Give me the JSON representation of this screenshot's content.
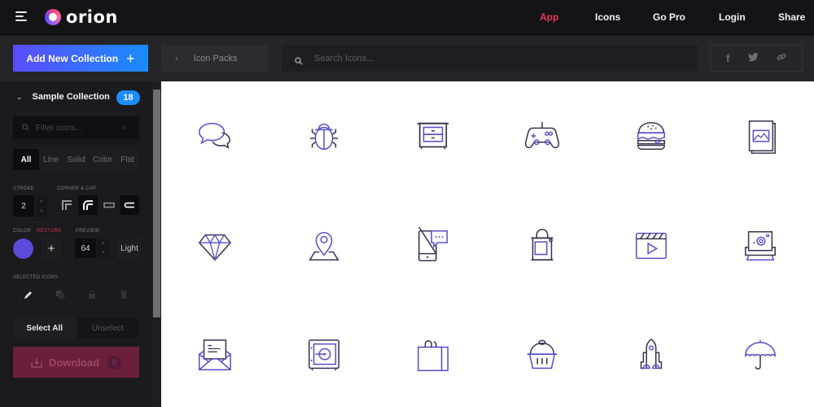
{
  "app": {
    "name": "orion"
  },
  "nav": [
    {
      "label": "App",
      "active": true
    },
    {
      "label": "Icons",
      "active": false
    },
    {
      "label": "Go Pro",
      "active": false
    },
    {
      "label": "Login",
      "active": false
    },
    {
      "label": "Share",
      "active": false
    }
  ],
  "toolbar": {
    "add_collection_label": "Add New Collection",
    "icon_packs_label": "Icon Packs",
    "search_placeholder": "Search Icons...",
    "share_icons": [
      "facebook-icon",
      "twitter-icon",
      "link-icon"
    ]
  },
  "sidebar": {
    "collection_title": "Sample Collection",
    "collection_count": "18",
    "filter_placeholder": "Filter icons...",
    "types": [
      "All",
      "Line",
      "Solid",
      "Color",
      "Flat"
    ],
    "active_type": "All",
    "stroke_label": "Stroke",
    "stroke_value": "2",
    "corner_cap_label": "Corner & Cap",
    "color_label": "Color",
    "restore_label": "Restore",
    "preview_label": "Preview",
    "preview_value": "64",
    "preview_theme": "Light",
    "selected_icons_label": "Selected Icons",
    "select_all_label": "Select All",
    "unselect_label": "Unselect",
    "download_label": "Download",
    "download_count": "0"
  },
  "colors": {
    "accent": "#5a4bdb",
    "active_nav": "#e8385a",
    "badge": "#1a8cff",
    "icon_primary": "#5a4fcf",
    "icon_secondary": "#3a3550"
  },
  "icons": [
    "chat-bubbles-icon",
    "bug-icon",
    "cabinet-icon",
    "gamepad-icon",
    "burger-icon",
    "photo-book-icon",
    "diamond-icon",
    "map-pin-icon",
    "mobile-chat-icon",
    "paint-bucket-icon",
    "video-clapper-icon",
    "instant-camera-icon",
    "open-envelope-icon",
    "safe-icon",
    "shopping-bag-icon",
    "cupcake-icon",
    "rocket-icon",
    "umbrella-icon"
  ]
}
